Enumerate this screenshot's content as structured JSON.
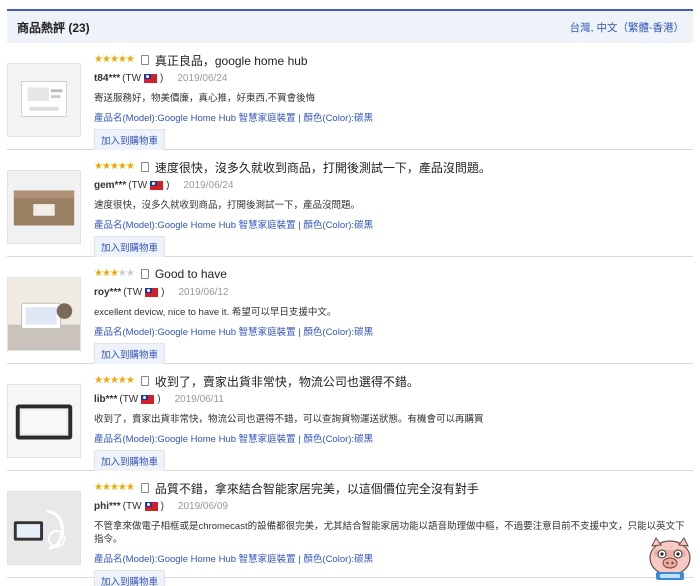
{
  "header": {
    "title": "商品熱評 (23)",
    "locale": "台灣, 中文（繁體-香港）"
  },
  "reviews": [
    {
      "stars": 5,
      "title": "真正良品，google home hub",
      "author": "t84***",
      "country": "TW",
      "date": "2019/06/24",
      "text": "寄送服務好，物美價廉，真心推，好東西,不買會後悔",
      "product": "產品名(Model):Google Home Hub 智慧家庭裝置 | 顏色(Color):碳黑",
      "cart_label": "加入到購物車"
    },
    {
      "stars": 5,
      "title": "速度很快，沒多久就收到商品，打開後測試一下，產品沒問題。",
      "author": "gem***",
      "country": "TW",
      "date": "2019/06/24",
      "text": "速度很快，沒多久就收到商品，打開後測試一下，產品沒問題。",
      "product": "產品名(Model):Google Home Hub 智慧家庭裝置 | 顏色(Color):碳黑",
      "cart_label": "加入到購物車"
    },
    {
      "stars": 3,
      "title": "Good to have",
      "author": "roy***",
      "country": "TW",
      "date": "2019/06/12",
      "text": "excellent devicw, nice to have it. 希望可以早日支援中文。",
      "product": "產品名(Model):Google Home Hub 智慧家庭裝置 | 顏色(Color):碳黑",
      "cart_label": "加入到購物車"
    },
    {
      "stars": 5,
      "title": "收到了，賣家出貨非常快，物流公司也選得不錯。",
      "author": "lib***",
      "country": "TW",
      "date": "2019/06/11",
      "text": "收到了，賣家出貨非常快，物流公司也選得不錯，可以查詢貨物運送狀態。有機會可以再購買",
      "product": "產品名(Model):Google Home Hub 智慧家庭裝置 | 顏色(Color):碳黑",
      "cart_label": "加入到購物車"
    },
    {
      "stars": 5,
      "title": "品質不錯，拿來結合智能家居完美，以這個價位完全沒有對手",
      "author": "phi***",
      "country": "TW",
      "date": "2019/06/09",
      "text": "不管拿來做電子相框或是chromecast的設備都很完美，尤其結合智能家居功能以語音助理做中樞，不過要注意目前不支援中文，只能以英文下指令。",
      "product": "產品名(Model):Google Home Hub 智慧家庭裝置 | 顏色(Color):碳黑",
      "cart_label": "加入到購物車"
    }
  ],
  "colors": {
    "accent": "#4a5ab8",
    "link": "#3355bb",
    "star": "#f4a700",
    "header_bg": "#eef2f9"
  }
}
